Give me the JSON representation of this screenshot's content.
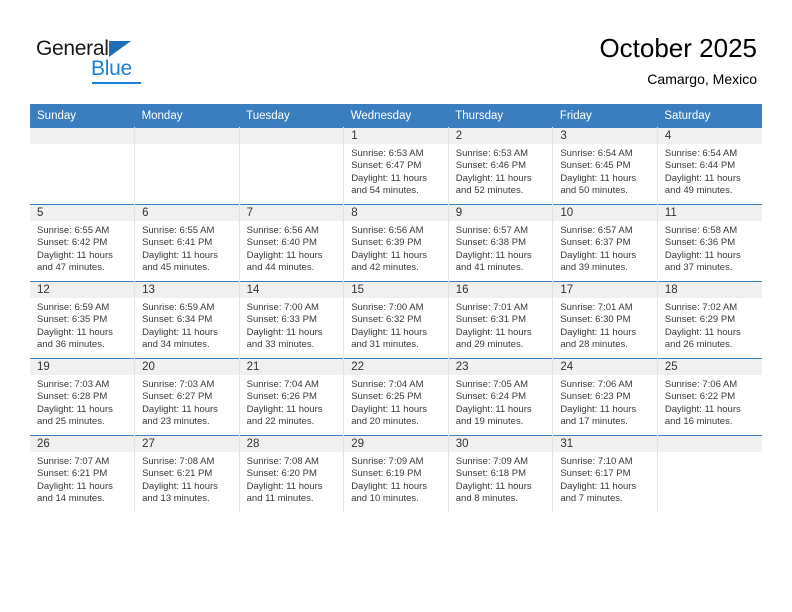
{
  "brand": {
    "name_top": "General",
    "name_bottom": "Blue",
    "accent_color": "#1c7fd6",
    "triangle_color": "#1c6fb5"
  },
  "header": {
    "title": "October 2025",
    "subtitle": "Camargo, Mexico"
  },
  "theme": {
    "header_row_bg": "#3a7ebf",
    "header_row_text": "#ffffff",
    "daynum_band_bg": "#f0f0f0",
    "cell_bg": "#ffffff",
    "cell_divider": "#e3e3e3",
    "row_top_border": "#3a7ebf"
  },
  "weekday_headers": [
    "Sunday",
    "Monday",
    "Tuesday",
    "Wednesday",
    "Thursday",
    "Friday",
    "Saturday"
  ],
  "labels": {
    "sunrise_prefix": "Sunrise:",
    "sunset_prefix": "Sunset:",
    "daylight_prefix": "Daylight:"
  },
  "weeks": [
    [
      {
        "empty": true
      },
      {
        "empty": true
      },
      {
        "empty": true
      },
      {
        "day": "1",
        "sunrise": "Sunrise: 6:53 AM",
        "sunset": "Sunset: 6:47 PM",
        "daylight_line1": "Daylight: 11 hours",
        "daylight_line2": "and 54 minutes."
      },
      {
        "day": "2",
        "sunrise": "Sunrise: 6:53 AM",
        "sunset": "Sunset: 6:46 PM",
        "daylight_line1": "Daylight: 11 hours",
        "daylight_line2": "and 52 minutes."
      },
      {
        "day": "3",
        "sunrise": "Sunrise: 6:54 AM",
        "sunset": "Sunset: 6:45 PM",
        "daylight_line1": "Daylight: 11 hours",
        "daylight_line2": "and 50 minutes."
      },
      {
        "day": "4",
        "sunrise": "Sunrise: 6:54 AM",
        "sunset": "Sunset: 6:44 PM",
        "daylight_line1": "Daylight: 11 hours",
        "daylight_line2": "and 49 minutes."
      }
    ],
    [
      {
        "day": "5",
        "sunrise": "Sunrise: 6:55 AM",
        "sunset": "Sunset: 6:42 PM",
        "daylight_line1": "Daylight: 11 hours",
        "daylight_line2": "and 47 minutes."
      },
      {
        "day": "6",
        "sunrise": "Sunrise: 6:55 AM",
        "sunset": "Sunset: 6:41 PM",
        "daylight_line1": "Daylight: 11 hours",
        "daylight_line2": "and 45 minutes."
      },
      {
        "day": "7",
        "sunrise": "Sunrise: 6:56 AM",
        "sunset": "Sunset: 6:40 PM",
        "daylight_line1": "Daylight: 11 hours",
        "daylight_line2": "and 44 minutes."
      },
      {
        "day": "8",
        "sunrise": "Sunrise: 6:56 AM",
        "sunset": "Sunset: 6:39 PM",
        "daylight_line1": "Daylight: 11 hours",
        "daylight_line2": "and 42 minutes."
      },
      {
        "day": "9",
        "sunrise": "Sunrise: 6:57 AM",
        "sunset": "Sunset: 6:38 PM",
        "daylight_line1": "Daylight: 11 hours",
        "daylight_line2": "and 41 minutes."
      },
      {
        "day": "10",
        "sunrise": "Sunrise: 6:57 AM",
        "sunset": "Sunset: 6:37 PM",
        "daylight_line1": "Daylight: 11 hours",
        "daylight_line2": "and 39 minutes."
      },
      {
        "day": "11",
        "sunrise": "Sunrise: 6:58 AM",
        "sunset": "Sunset: 6:36 PM",
        "daylight_line1": "Daylight: 11 hours",
        "daylight_line2": "and 37 minutes."
      }
    ],
    [
      {
        "day": "12",
        "sunrise": "Sunrise: 6:59 AM",
        "sunset": "Sunset: 6:35 PM",
        "daylight_line1": "Daylight: 11 hours",
        "daylight_line2": "and 36 minutes."
      },
      {
        "day": "13",
        "sunrise": "Sunrise: 6:59 AM",
        "sunset": "Sunset: 6:34 PM",
        "daylight_line1": "Daylight: 11 hours",
        "daylight_line2": "and 34 minutes."
      },
      {
        "day": "14",
        "sunrise": "Sunrise: 7:00 AM",
        "sunset": "Sunset: 6:33 PM",
        "daylight_line1": "Daylight: 11 hours",
        "daylight_line2": "and 33 minutes."
      },
      {
        "day": "15",
        "sunrise": "Sunrise: 7:00 AM",
        "sunset": "Sunset: 6:32 PM",
        "daylight_line1": "Daylight: 11 hours",
        "daylight_line2": "and 31 minutes."
      },
      {
        "day": "16",
        "sunrise": "Sunrise: 7:01 AM",
        "sunset": "Sunset: 6:31 PM",
        "daylight_line1": "Daylight: 11 hours",
        "daylight_line2": "and 29 minutes."
      },
      {
        "day": "17",
        "sunrise": "Sunrise: 7:01 AM",
        "sunset": "Sunset: 6:30 PM",
        "daylight_line1": "Daylight: 11 hours",
        "daylight_line2": "and 28 minutes."
      },
      {
        "day": "18",
        "sunrise": "Sunrise: 7:02 AM",
        "sunset": "Sunset: 6:29 PM",
        "daylight_line1": "Daylight: 11 hours",
        "daylight_line2": "and 26 minutes."
      }
    ],
    [
      {
        "day": "19",
        "sunrise": "Sunrise: 7:03 AM",
        "sunset": "Sunset: 6:28 PM",
        "daylight_line1": "Daylight: 11 hours",
        "daylight_line2": "and 25 minutes."
      },
      {
        "day": "20",
        "sunrise": "Sunrise: 7:03 AM",
        "sunset": "Sunset: 6:27 PM",
        "daylight_line1": "Daylight: 11 hours",
        "daylight_line2": "and 23 minutes."
      },
      {
        "day": "21",
        "sunrise": "Sunrise: 7:04 AM",
        "sunset": "Sunset: 6:26 PM",
        "daylight_line1": "Daylight: 11 hours",
        "daylight_line2": "and 22 minutes."
      },
      {
        "day": "22",
        "sunrise": "Sunrise: 7:04 AM",
        "sunset": "Sunset: 6:25 PM",
        "daylight_line1": "Daylight: 11 hours",
        "daylight_line2": "and 20 minutes."
      },
      {
        "day": "23",
        "sunrise": "Sunrise: 7:05 AM",
        "sunset": "Sunset: 6:24 PM",
        "daylight_line1": "Daylight: 11 hours",
        "daylight_line2": "and 19 minutes."
      },
      {
        "day": "24",
        "sunrise": "Sunrise: 7:06 AM",
        "sunset": "Sunset: 6:23 PM",
        "daylight_line1": "Daylight: 11 hours",
        "daylight_line2": "and 17 minutes."
      },
      {
        "day": "25",
        "sunrise": "Sunrise: 7:06 AM",
        "sunset": "Sunset: 6:22 PM",
        "daylight_line1": "Daylight: 11 hours",
        "daylight_line2": "and 16 minutes."
      }
    ],
    [
      {
        "day": "26",
        "sunrise": "Sunrise: 7:07 AM",
        "sunset": "Sunset: 6:21 PM",
        "daylight_line1": "Daylight: 11 hours",
        "daylight_line2": "and 14 minutes."
      },
      {
        "day": "27",
        "sunrise": "Sunrise: 7:08 AM",
        "sunset": "Sunset: 6:21 PM",
        "daylight_line1": "Daylight: 11 hours",
        "daylight_line2": "and 13 minutes."
      },
      {
        "day": "28",
        "sunrise": "Sunrise: 7:08 AM",
        "sunset": "Sunset: 6:20 PM",
        "daylight_line1": "Daylight: 11 hours",
        "daylight_line2": "and 11 minutes."
      },
      {
        "day": "29",
        "sunrise": "Sunrise: 7:09 AM",
        "sunset": "Sunset: 6:19 PM",
        "daylight_line1": "Daylight: 11 hours",
        "daylight_line2": "and 10 minutes."
      },
      {
        "day": "30",
        "sunrise": "Sunrise: 7:09 AM",
        "sunset": "Sunset: 6:18 PM",
        "daylight_line1": "Daylight: 11 hours",
        "daylight_line2": "and 8 minutes."
      },
      {
        "day": "31",
        "sunrise": "Sunrise: 7:10 AM",
        "sunset": "Sunset: 6:17 PM",
        "daylight_line1": "Daylight: 11 hours",
        "daylight_line2": "and 7 minutes."
      },
      {
        "empty": true
      }
    ]
  ]
}
